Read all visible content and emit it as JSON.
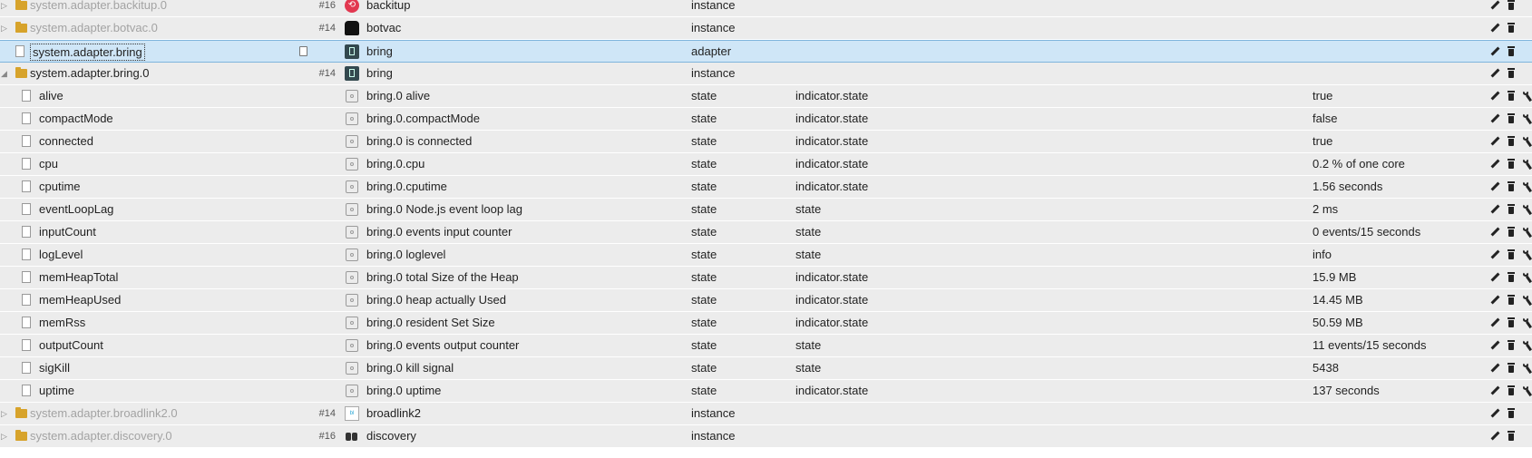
{
  "rows": [
    {
      "id": "system.adapter.backitup.0",
      "kind": "folder",
      "expand": "closed",
      "muted": true,
      "count": "#16",
      "icon": "red",
      "name": "backitup",
      "type": "instance",
      "role": "",
      "value": "",
      "actions": [
        "edit",
        "delete"
      ]
    },
    {
      "id": "system.adapter.botvac.0",
      "kind": "folder",
      "expand": "closed",
      "muted": true,
      "count": "#14",
      "icon": "black",
      "name": "botvac",
      "type": "instance",
      "role": "",
      "value": "",
      "actions": [
        "edit",
        "delete"
      ]
    },
    {
      "id": "system.adapter.bring",
      "kind": "file-top",
      "expand": "",
      "muted": false,
      "count": "",
      "icon": "bring",
      "name": "bring",
      "type": "adapter",
      "role": "",
      "value": "",
      "actions": [
        "edit",
        "delete"
      ],
      "selected": true
    },
    {
      "id": "system.adapter.bring.0",
      "kind": "folder",
      "expand": "open",
      "muted": false,
      "count": "#14",
      "icon": "bring",
      "name": "bring",
      "type": "instance",
      "role": "",
      "value": "",
      "actions": [
        "edit",
        "delete"
      ]
    },
    {
      "id": "alive",
      "kind": "file",
      "name": "bring.0 alive",
      "icon": "state",
      "type": "state",
      "role": "indicator.state",
      "value": "true",
      "actions": [
        "edit",
        "delete",
        "config"
      ]
    },
    {
      "id": "compactMode",
      "kind": "file",
      "name": "bring.0.compactMode",
      "icon": "state",
      "type": "state",
      "role": "indicator.state",
      "value": "false",
      "actions": [
        "edit",
        "delete",
        "config"
      ]
    },
    {
      "id": "connected",
      "kind": "file",
      "name": "bring.0 is connected",
      "icon": "state",
      "type": "state",
      "role": "indicator.state",
      "value": "true",
      "actions": [
        "edit",
        "delete",
        "config"
      ]
    },
    {
      "id": "cpu",
      "kind": "file",
      "name": "bring.0.cpu",
      "icon": "state",
      "type": "state",
      "role": "indicator.state",
      "value": "0.2 % of one core",
      "actions": [
        "edit",
        "delete",
        "config"
      ]
    },
    {
      "id": "cputime",
      "kind": "file",
      "name": "bring.0.cputime",
      "icon": "state",
      "type": "state",
      "role": "indicator.state",
      "value": "1.56 seconds",
      "actions": [
        "edit",
        "delete",
        "config"
      ]
    },
    {
      "id": "eventLoopLag",
      "kind": "file",
      "name": "bring.0 Node.js event loop lag",
      "icon": "state",
      "type": "state",
      "role": "state",
      "value": "2 ms",
      "actions": [
        "edit",
        "delete",
        "config"
      ]
    },
    {
      "id": "inputCount",
      "kind": "file",
      "name": "bring.0 events input counter",
      "icon": "state",
      "type": "state",
      "role": "state",
      "value": "0 events/15 seconds",
      "actions": [
        "edit",
        "delete",
        "config"
      ]
    },
    {
      "id": "logLevel",
      "kind": "file",
      "name": "bring.0 loglevel",
      "icon": "state",
      "type": "state",
      "role": "state",
      "value": "info",
      "actions": [
        "edit",
        "delete",
        "config"
      ]
    },
    {
      "id": "memHeapTotal",
      "kind": "file",
      "name": "bring.0 total Size of the Heap",
      "icon": "state",
      "type": "state",
      "role": "indicator.state",
      "value": "15.9 MB",
      "actions": [
        "edit",
        "delete",
        "config"
      ]
    },
    {
      "id": "memHeapUsed",
      "kind": "file",
      "name": "bring.0 heap actually Used",
      "icon": "state",
      "type": "state",
      "role": "indicator.state",
      "value": "14.45 MB",
      "actions": [
        "edit",
        "delete",
        "config"
      ]
    },
    {
      "id": "memRss",
      "kind": "file",
      "name": "bring.0 resident Set Size",
      "icon": "state",
      "type": "state",
      "role": "indicator.state",
      "value": "50.59 MB",
      "actions": [
        "edit",
        "delete",
        "config"
      ]
    },
    {
      "id": "outputCount",
      "kind": "file",
      "name": "bring.0 events output counter",
      "icon": "state",
      "type": "state",
      "role": "state",
      "value": "11 events/15 seconds",
      "actions": [
        "edit",
        "delete",
        "config"
      ]
    },
    {
      "id": "sigKill",
      "kind": "file",
      "name": "bring.0 kill signal",
      "icon": "state",
      "type": "state",
      "role": "state",
      "value": "5438",
      "actions": [
        "edit",
        "delete",
        "config"
      ]
    },
    {
      "id": "uptime",
      "kind": "file",
      "name": "bring.0 uptime",
      "icon": "state",
      "type": "state",
      "role": "indicator.state",
      "value": "137 seconds",
      "actions": [
        "edit",
        "delete",
        "config"
      ]
    },
    {
      "id": "system.adapter.broadlink2.0",
      "kind": "folder",
      "expand": "closed",
      "muted": true,
      "count": "#14",
      "icon": "bl",
      "name": "broadlink2",
      "type": "instance",
      "role": "",
      "value": "",
      "actions": [
        "edit",
        "delete"
      ]
    },
    {
      "id": "system.adapter.discovery.0",
      "kind": "folder",
      "expand": "closed",
      "muted": true,
      "count": "#16",
      "icon": "disc",
      "name": "discovery",
      "type": "instance",
      "role": "",
      "value": "",
      "actions": [
        "edit",
        "delete"
      ]
    }
  ],
  "icons": {
    "backitup": "backitup-clock-icon",
    "botvac": "botvac-robot-icon",
    "bring": "bring-adapter-icon",
    "broadlink2": "broadlink-logo-icon",
    "discovery": "binoculars-icon",
    "state": "state-object-icon"
  }
}
